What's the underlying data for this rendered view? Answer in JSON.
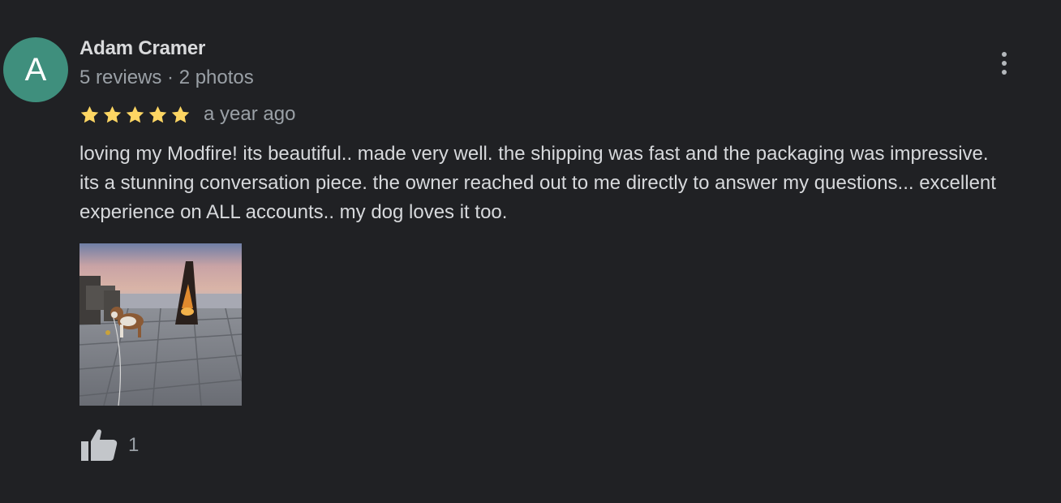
{
  "review": {
    "author": {
      "initial": "A",
      "name": "Adam Cramer",
      "meta": "5 reviews · 2 photos",
      "avatar_color": "#3f8f7d"
    },
    "rating": {
      "stars": 5,
      "max": 5,
      "star_color": "#fdd663"
    },
    "timestamp": "a year ago",
    "text": "loving my Modfire! its beautiful.. made very well. the shipping was fast and the packaging was impressive. its a stunning conversation piece. the owner reached out to me directly to answer my questions... excellent experience on ALL accounts.. my dog loves it too.",
    "photos": [
      {
        "icon": "photo-thumbnail-firepit-with-dog"
      }
    ],
    "likes": {
      "count": "1",
      "icon": "thumbs-up-icon"
    },
    "more_icon": "more-vertical-icon"
  }
}
